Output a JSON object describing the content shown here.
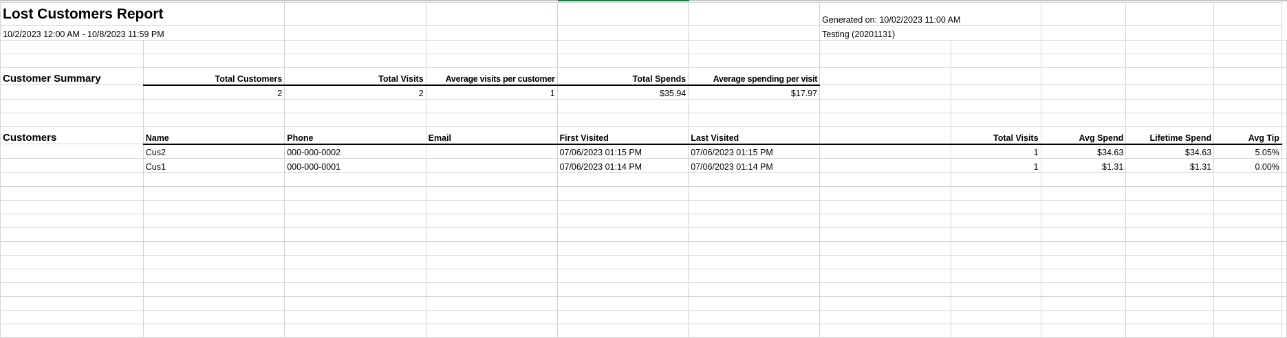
{
  "report": {
    "title": "Lost Customers Report",
    "date_range": "10/2/2023 12:00 AM - 10/8/2023 11:59 PM",
    "generated_on": "Generated on: 10/02/2023 11:00 AM",
    "store": "Testing (20201131)"
  },
  "summary": {
    "section_label": "Customer Summary",
    "headers": [
      "Total Customers",
      "Total Visits",
      "Average visits per customer",
      "Total Spends",
      "Average spending per visit"
    ],
    "values": [
      "2",
      "2",
      "1",
      "$35.94",
      "$17.97"
    ]
  },
  "customers": {
    "section_label": "Customers",
    "headers": [
      "Name",
      "Phone",
      "Email",
      "First Visited",
      "Last Visited",
      "Total Visits",
      "Avg Spend",
      "Lifetime Spend",
      "Avg Tip"
    ],
    "rows": [
      [
        "Cus2",
        "000-000-0002",
        "",
        "07/06/2023 01:15 PM",
        "07/06/2023 01:15 PM",
        "1",
        "$34.63",
        "$34.63",
        "5.05%"
      ],
      [
        "Cus1",
        "000-000-0001",
        "",
        "07/06/2023 01:14 PM",
        "07/06/2023 01:14 PM",
        "1",
        "$1.31",
        "$1.31",
        "0.00%"
      ]
    ]
  }
}
